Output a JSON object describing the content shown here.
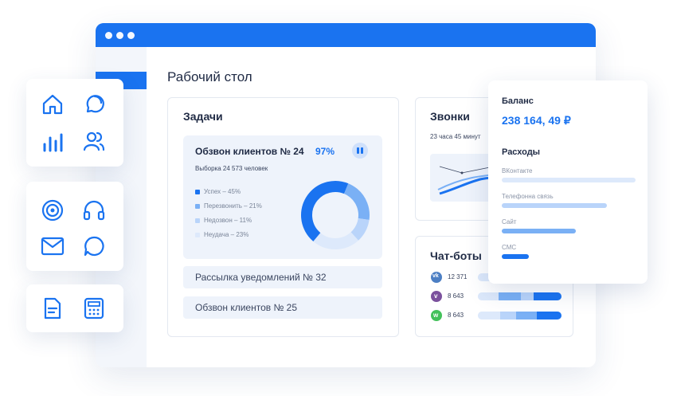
{
  "app": {
    "page_title": "Рабочий стол"
  },
  "colors": {
    "accent": "#1a73f0",
    "light_blue": "#7ab0f5",
    "pale_blue": "#b9d4fa",
    "paler_blue": "#dde9fb"
  },
  "nav_icons": [
    "home-icon",
    "chat-icon",
    "chart-icon",
    "users-icon",
    "target-icon",
    "headset-icon",
    "mail-icon",
    "message-icon",
    "document-icon",
    "calculator-icon"
  ],
  "tasks": {
    "title": "Задачи",
    "active": {
      "name": "Обзвон клиентов № 24",
      "percent": "97%",
      "sample": "Выборка 24 573 человек",
      "legend": [
        {
          "label": "Успех – 45%",
          "value": 45,
          "color": "#1a73f0"
        },
        {
          "label": "Перезвонить – 21%",
          "value": 21,
          "color": "#7ab0f5"
        },
        {
          "label": "Недозвон – 11%",
          "value": 11,
          "color": "#b9d4fa"
        },
        {
          "label": "Неудача – 23%",
          "value": 23,
          "color": "#dde9fb"
        }
      ]
    },
    "rows": [
      "Рассылка уведомлений № 32",
      "Обзвон клиентов № 25"
    ]
  },
  "calls": {
    "title": "Звонки",
    "duration": "23 часа 45 минут"
  },
  "chatbots": {
    "title": "Чат-боты",
    "rows": [
      {
        "icon": "vk-icon",
        "icon_label": "vk",
        "count": "12 371"
      },
      {
        "icon": "viber-icon",
        "icon_label": "v",
        "count": "8 643"
      },
      {
        "icon": "whatsapp-icon",
        "icon_label": "w",
        "count": "8 643"
      }
    ]
  },
  "balance": {
    "label": "Баланс",
    "amount": "238 164, 49 ₽",
    "expenses_title": "Расходы",
    "expenses": [
      {
        "label": "ВКонтакте"
      },
      {
        "label": "Телефонна связь"
      },
      {
        "label": "Сайт"
      },
      {
        "label": "СМС"
      }
    ]
  }
}
